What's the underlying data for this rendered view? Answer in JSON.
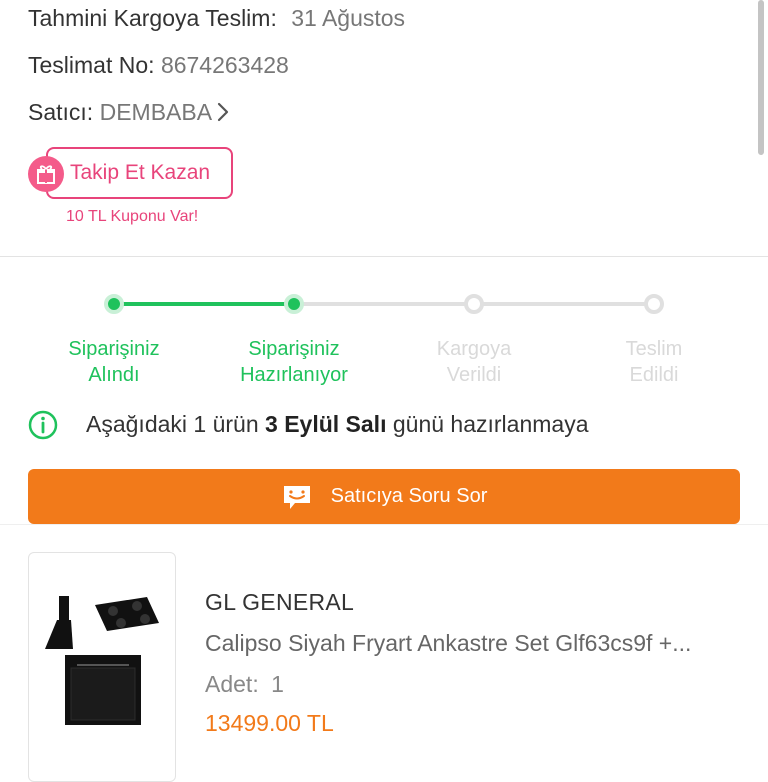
{
  "shipping": {
    "estimate_label": "Tahmini Kargoya Teslim:",
    "estimate_value": "31 Ağustos",
    "delivery_no_label": "Teslimat No:",
    "delivery_no_value": "8674263428",
    "seller_label": "Satıcı:",
    "seller_value": "DEMBABA"
  },
  "promo": {
    "follow_label": "Takip Et Kazan",
    "coupon_text": "10 TL Kuponu Var!",
    "accent_color": "#e8447b"
  },
  "steps": [
    {
      "line1": "Siparişiniz",
      "line2": "Alındı",
      "state": "done"
    },
    {
      "line1": "Siparişiniz",
      "line2": "Hazırlanıyor",
      "state": "done"
    },
    {
      "line1": "Kargoya",
      "line2": "Verildi",
      "state": "pending"
    },
    {
      "line1": "Teslim",
      "line2": "Edildi",
      "state": "pending"
    }
  ],
  "notice": {
    "prefix": "Aşağıdaki 1 ürün",
    "date_bold": "3 Eylül Salı",
    "suffix": "günü hazırlanmaya",
    "icon": "info-icon"
  },
  "ask_seller": {
    "label": "Satıcıya Soru Sor",
    "icon": "chat-smile-icon",
    "color": "#f27a1a"
  },
  "product": {
    "brand": "GL GENERAL",
    "title": "Calipso Siyah Fryart Ankastre Set Glf63cs9f +...",
    "qty_label": "Adet:",
    "qty_value": "1",
    "price": "13499.00 TL"
  },
  "colors": {
    "success": "#1fc25c",
    "pending": "#e0e0e0"
  }
}
